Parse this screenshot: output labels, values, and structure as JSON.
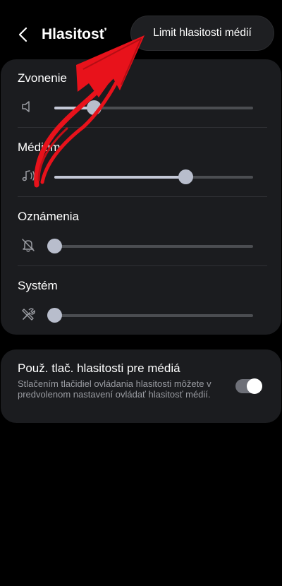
{
  "header": {
    "title": "Hlasitosť",
    "menu_item": "Limit hlasitosti médií"
  },
  "volume": [
    {
      "label": "Zvonenie",
      "icon": "speaker-icon",
      "level_percent": 20
    },
    {
      "label": "Médium",
      "icon": "music-note-icon",
      "level_percent": 66
    },
    {
      "label": "Oznámenia",
      "icon": "bell-muted-icon",
      "level_percent": 0
    },
    {
      "label": "Systém",
      "icon": "system-tools-icon",
      "level_percent": 0
    }
  ],
  "media_keys": {
    "title": "Použ. tlač. hlasitosti pre médiá",
    "description": "Stlačením tlačidiel ovládania hlasitosti môžete v predvolenom nastavení ovládať hlasitosť médií.",
    "enabled": true
  },
  "colors": {
    "background": "#000000",
    "card": "#1b1c1f",
    "slider_track": "#4b4d51",
    "slider_fill": "#c4c8d6",
    "annotation_arrow": "#e8121b"
  }
}
